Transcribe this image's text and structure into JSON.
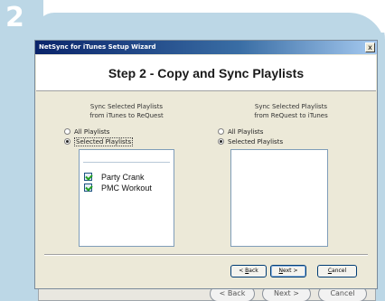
{
  "step_number": "2",
  "dialog": {
    "title": "NetSync for iTunes Setup Wizard",
    "close_glyph": "x",
    "heading": "Step 2 - Copy and Sync Playlists"
  },
  "left_panel": {
    "caption_line1": "Sync Selected Playlists",
    "caption_line2": "from iTunes to ReQuest",
    "options": [
      {
        "label": "All Playlists",
        "selected": false
      },
      {
        "label": "Selected Playlists",
        "selected": true
      }
    ],
    "playlists": [
      {
        "name": "Party Crank",
        "checked": true
      },
      {
        "name": "PMC Workout",
        "checked": true
      }
    ]
  },
  "right_panel": {
    "caption_line1": "Sync Selected Playlists",
    "caption_line2": "from ReQuest to iTunes",
    "options": [
      {
        "label": "All Playlists",
        "selected": false
      },
      {
        "label": "Selected Playlists",
        "selected": true
      }
    ],
    "playlists": []
  },
  "buttons": {
    "back": {
      "mnemonic": "B",
      "rest": "ack",
      "prefix": "< "
    },
    "next": {
      "mnemonic": "N",
      "rest": "ext",
      "suffix": " >"
    },
    "cancel": {
      "mnemonic": "C",
      "rest": "ancel"
    }
  },
  "ghost_buttons": {
    "back": "< Back",
    "next": "Next >",
    "cancel": "Cancel"
  },
  "colors": {
    "accent_band": "#bcd7e6",
    "titlebar_start": "#0a246a",
    "dialog_face": "#ece9d8"
  }
}
